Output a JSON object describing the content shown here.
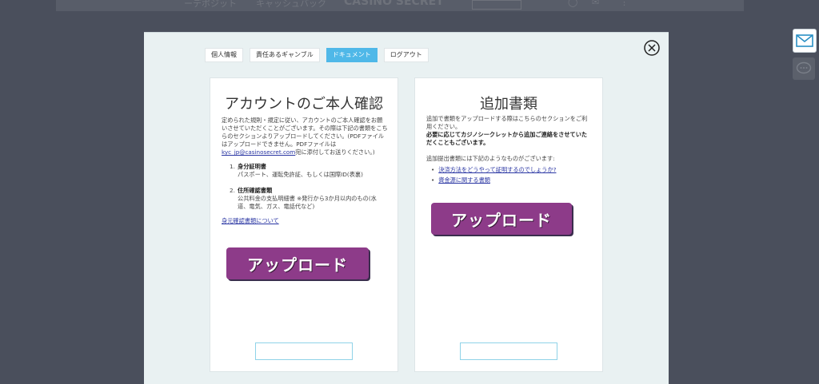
{
  "background_header": {
    "item1": "ーデポジット",
    "item2": "キャッシュバック",
    "logo": "CASINO SECRET"
  },
  "modal": {
    "tabs": [
      {
        "label": "個人情報",
        "active": false
      },
      {
        "label": "責任あるギャンブル",
        "active": false
      },
      {
        "label": "ドキュメント",
        "active": true
      },
      {
        "label": "ログアウト",
        "active": false
      }
    ],
    "left_panel": {
      "title": "アカウントのご本人確認",
      "description_part1": "定められた規則・規定に従い、アカウントのご本人確認をお願いさせていただくことがございます。その際は下記の書類をこちらのセクションよりアップロードしてください。(PDFファイルはアップロードできません。PDFファイルは",
      "email_link": "kyc_jp@casinosecret.com",
      "description_part2": "宛に添付してお送りください。)",
      "documents": [
        {
          "number": "1.",
          "title": "身分証明書",
          "detail": "パスポート、運転免許証、もしくは国際ID(表裏)"
        },
        {
          "number": "2.",
          "title": "住所確認書類",
          "detail": "公共料金の支払明細書 ※発行から3か月以内のもの(水道、電気、ガス、電話代など)"
        }
      ],
      "about_link": "身元確認書類について",
      "upload_label": "アップロード"
    },
    "right_panel": {
      "title": "追加書類",
      "description": "追加で書類をアップロードする際はこちらのセクションをご利用ください。",
      "description_bold": "必要に応じてカジノシークレットから追加ご連絡をさせていただくこともございます。",
      "list_intro": "追加提出書類には下記のようなものがございます:",
      "links": [
        "決済方法をどうやって証明するのでしょうか?",
        "資金源に関する書類"
      ],
      "upload_label": "アップロード"
    }
  },
  "colors": {
    "upload_button": "#8d3b89",
    "active_tab": "#4fb8e8",
    "overlay": "#4a4f5c",
    "modal_bg": "#e9f1f2"
  },
  "icons": {
    "close": "close-circle-icon",
    "mail": "mail-icon",
    "chat": "chat-bubble-icon"
  }
}
